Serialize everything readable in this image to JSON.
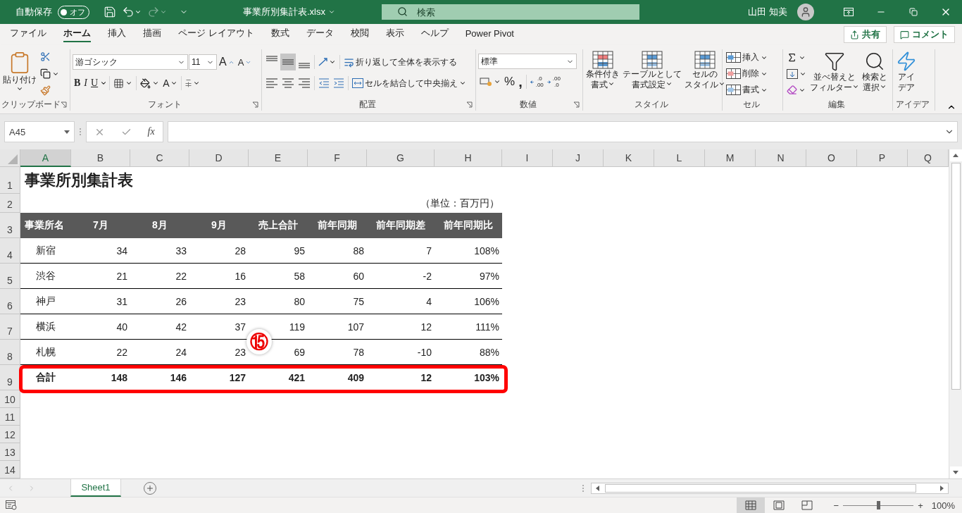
{
  "title_bar": {
    "autosave_label": "自動保存",
    "autosave_state": "オフ",
    "autosave_on": false,
    "file_name": "事業所別集計表.xlsx",
    "search_placeholder": "検索",
    "user_name": "山田 知美"
  },
  "ribbon_tabs": [
    {
      "label": "ファイル",
      "selected": false
    },
    {
      "label": "ホーム",
      "selected": true
    },
    {
      "label": "挿入",
      "selected": false
    },
    {
      "label": "描画",
      "selected": false
    },
    {
      "label": "ページ レイアウト",
      "selected": false
    },
    {
      "label": "数式",
      "selected": false
    },
    {
      "label": "データ",
      "selected": false
    },
    {
      "label": "校閲",
      "selected": false
    },
    {
      "label": "表示",
      "selected": false
    },
    {
      "label": "ヘルプ",
      "selected": false
    },
    {
      "label": "Power Pivot",
      "selected": false
    }
  ],
  "share_button": "共有",
  "comment_button": "コメント",
  "clipboard": {
    "group": "クリップボード",
    "paste": "貼り付け"
  },
  "font": {
    "group": "フォント",
    "font_name": "游ゴシック",
    "font_size": "11",
    "size_buttons": [
      "A",
      "A"
    ],
    "styles": [
      "B",
      "I",
      "U"
    ],
    "color_letter": "A"
  },
  "alignment": {
    "group": "配置",
    "vertical": [
      {
        "selected": false
      },
      {
        "selected": true
      },
      {
        "selected": false
      }
    ],
    "horizontal": [
      {
        "selected": false
      },
      {
        "selected": false
      },
      {
        "selected": false
      }
    ],
    "wrap_text": "折り返して全体を表示する",
    "merge_center": "セルを結合して中央揃え"
  },
  "number": {
    "group": "数値",
    "format": "標準",
    "percent": "%",
    "comma": ",",
    "decimals": [
      {
        "top": ".0",
        "bottom": ".00"
      },
      {
        "top": ".00",
        "bottom": ".0"
      }
    ]
  },
  "styles": {
    "group": "スタイル",
    "buttons": [
      {
        "lines": [
          "条件付き",
          "書式"
        ]
      },
      {
        "lines": [
          "テーブルとして",
          "書式設定"
        ]
      },
      {
        "lines": [
          "セルの",
          "スタイル"
        ]
      }
    ]
  },
  "cells": {
    "group": "セル",
    "buttons": [
      "挿入",
      "削除",
      "書式"
    ]
  },
  "editing": {
    "group": "編集",
    "buttons": [
      {
        "lines": [
          "並べ替えと",
          "フィルター"
        ]
      },
      {
        "lines": [
          "検索と",
          "選択"
        ]
      }
    ]
  },
  "ideas": {
    "group": "アイデア",
    "lines": [
      "アイ",
      "デア"
    ]
  },
  "formula_bar": {
    "name_box": "A45",
    "function_label": "fx"
  },
  "columns": [
    {
      "label": "A",
      "selected": true
    },
    {
      "label": "B",
      "selected": false
    },
    {
      "label": "C",
      "selected": false
    },
    {
      "label": "D",
      "selected": false
    },
    {
      "label": "E",
      "selected": false
    },
    {
      "label": "F",
      "selected": false
    },
    {
      "label": "G",
      "selected": false
    },
    {
      "label": "H",
      "selected": false
    },
    {
      "label": "I",
      "selected": false
    },
    {
      "label": "J",
      "selected": false
    },
    {
      "label": "K",
      "selected": false
    },
    {
      "label": "L",
      "selected": false
    },
    {
      "label": "M",
      "selected": false
    },
    {
      "label": "N",
      "selected": false
    },
    {
      "label": "O",
      "selected": false
    },
    {
      "label": "P",
      "selected": false
    },
    {
      "label": "Q",
      "selected": false
    }
  ],
  "rows": [
    "1",
    "2",
    "3",
    "4",
    "5",
    "6",
    "7",
    "8",
    "9",
    "10",
    "11",
    "12",
    "13",
    "14"
  ],
  "sheet": {
    "title": "事業所別集計表",
    "unit": "（単位：百万円）",
    "header": [
      "事業所名",
      "7月",
      "8月",
      "9月",
      "売上合計",
      "前年同期",
      "前年同期差",
      "前年同期比"
    ],
    "data": [
      [
        "新宿",
        "34",
        "33",
        "28",
        "95",
        "88",
        "7",
        "108%"
      ],
      [
        "渋谷",
        "21",
        "22",
        "16",
        "58",
        "60",
        "-2",
        "97%"
      ],
      [
        "神戸",
        "31",
        "26",
        "23",
        "80",
        "75",
        "4",
        "106%"
      ],
      [
        "横浜",
        "40",
        "42",
        "37",
        "119",
        "107",
        "12",
        "111%"
      ],
      [
        "札幌",
        "22",
        "24",
        "23",
        "69",
        "78",
        "-10",
        "88%"
      ]
    ],
    "total": {
      "cells": [
        "合計",
        "148",
        "146",
        "127",
        "421",
        "409",
        "12",
        "103%"
      ],
      "highlighted": true
    }
  },
  "annotation": {
    "callout": "⑮"
  },
  "sheet_tabs": [
    {
      "label": "Sheet1",
      "selected": true
    }
  ],
  "status_bar": {
    "views": [
      {
        "selected": true
      },
      {
        "selected": false
      },
      {
        "selected": false
      }
    ],
    "zoom_out": "−",
    "zoom_slider": {
      "level": 0.5
    },
    "zoom_in": "+",
    "zoom": "100%"
  }
}
